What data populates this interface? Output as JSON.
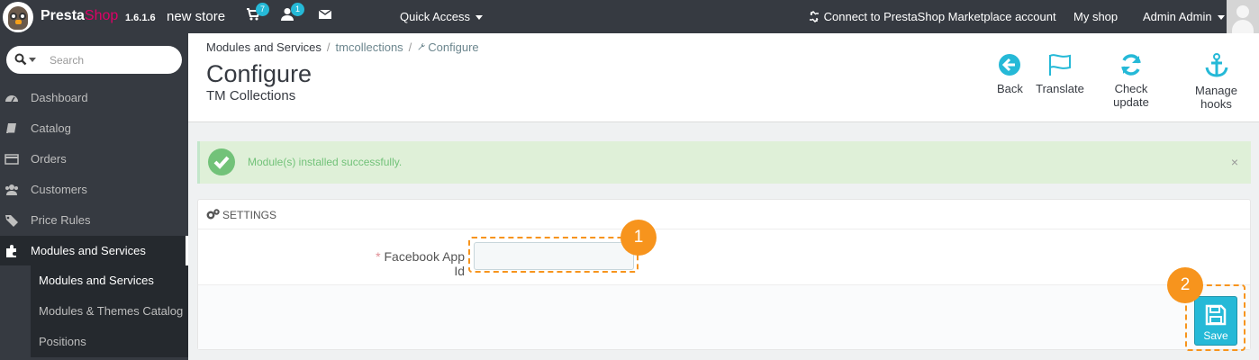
{
  "topbar": {
    "brand_presta": "Presta",
    "brand_shop": "Shop",
    "version": "1.6.1.6",
    "store_name": "new store",
    "cart_badge": "7",
    "customer_badge": "1",
    "quick_access": "Quick Access",
    "connect": "Connect to PrestaShop Marketplace account",
    "my_shop": "My shop",
    "admin": "Admin Admin"
  },
  "sidebar": {
    "search_placeholder": "Search",
    "items": [
      {
        "label": "Dashboard",
        "icon": "dashboard-icon"
      },
      {
        "label": "Catalog",
        "icon": "book-icon"
      },
      {
        "label": "Orders",
        "icon": "credit-card-icon"
      },
      {
        "label": "Customers",
        "icon": "users-icon"
      },
      {
        "label": "Price Rules",
        "icon": "tag-icon"
      },
      {
        "label": "Modules and Services",
        "icon": "puzzle-icon"
      }
    ],
    "subitems": [
      {
        "label": "Modules and Services"
      },
      {
        "label": "Modules & Themes Catalog"
      },
      {
        "label": "Positions"
      }
    ]
  },
  "header": {
    "breadcrumb": [
      "Modules and Services",
      "tmcollections",
      "Configure"
    ],
    "title": "Configure",
    "subtitle": "TM Collections",
    "toolbar": {
      "back": "Back",
      "translate": "Translate",
      "check_update": "Check update",
      "manage_hooks": "Manage hooks"
    }
  },
  "alert": {
    "message": "Module(s) installed successfully.",
    "close": "×"
  },
  "settings": {
    "heading": "SETTINGS",
    "required_mark": "*",
    "field_label": "Facebook App Id",
    "field_value": "",
    "save_label": "Save"
  },
  "annotations": {
    "marker_1": "1",
    "marker_2": "2"
  },
  "colors": {
    "topbar": "#363a41",
    "accent": "#25b9d7",
    "success": "#72c279",
    "annotation": "#f7941d"
  }
}
